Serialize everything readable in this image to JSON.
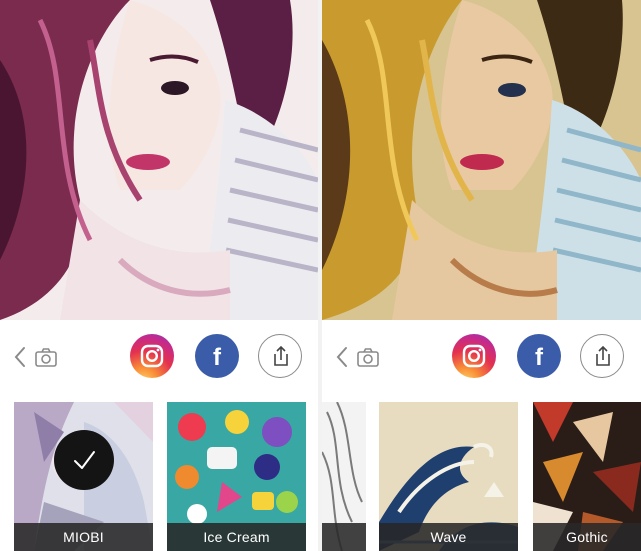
{
  "left_panel": {
    "style_name": "miobi",
    "toolbar": {
      "back_icon": "chevron-left-icon",
      "camera_icon": "camera-icon",
      "instagram_icon": "instagram-icon",
      "facebook_glyph": "f",
      "share_icon": "share-icon"
    },
    "filters": [
      {
        "label": "MIOBI",
        "selected": true
      },
      {
        "label": "Ice Cream",
        "selected": false
      }
    ]
  },
  "right_panel": {
    "style_name": "wave",
    "toolbar": {
      "back_icon": "chevron-left-icon",
      "camera_icon": "camera-icon",
      "instagram_icon": "instagram-icon",
      "facebook_glyph": "f",
      "share_icon": "share-icon"
    },
    "filters": [
      {
        "label": "",
        "selected": false
      },
      {
        "label": "Wave",
        "selected": false
      },
      {
        "label": "Gothic",
        "selected": false
      }
    ]
  },
  "colors": {
    "instagram_gradient": [
      "#fdd56e",
      "#fa8f37",
      "#e3314f",
      "#c32a8f",
      "#7a3eb8"
    ],
    "facebook_blue": "#3b5ca8",
    "label_bar": "#282828",
    "check_circle": "#141414"
  }
}
